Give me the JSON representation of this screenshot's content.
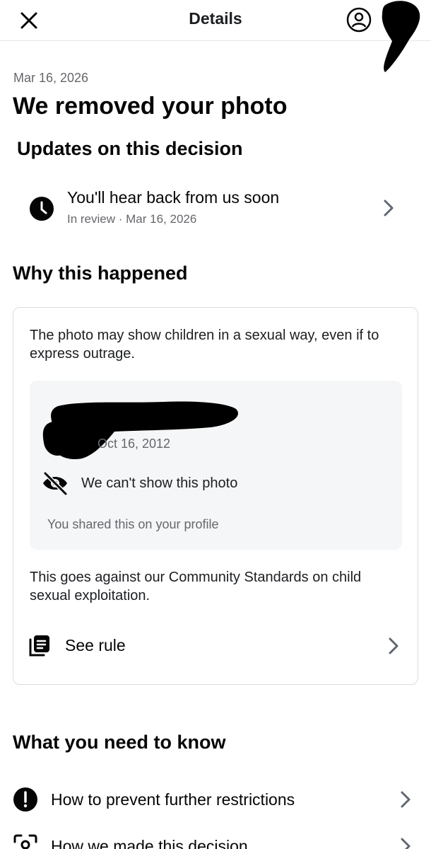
{
  "header": {
    "title": "Details",
    "close_icon": "close-icon",
    "account_icon": "account-circle-icon"
  },
  "notice": {
    "date": "Mar 16, 2026",
    "headline": "We removed your photo"
  },
  "updates": {
    "heading": "Updates on this decision",
    "item": {
      "icon": "clock-icon",
      "title": "You'll hear back from us soon",
      "subtitle": "In review · Mar 16, 2026"
    }
  },
  "why": {
    "heading": "Why this happened",
    "reason": "The photo may show children in a sexual way, even if to express outrage.",
    "post": {
      "date": "Oct 16, 2012",
      "hidden_notice": "We can't show this photo",
      "hidden_icon": "eye-off-icon",
      "shared_text": "You shared this on your profile"
    },
    "standards_text": "This goes against our Community Standards on child sexual exploitation.",
    "rule_link": {
      "label": "See rule",
      "icon": "rulebook-icon"
    }
  },
  "know": {
    "heading": "What you need to know",
    "items": [
      {
        "label": "How to prevent further restrictions",
        "icon": "alert-circle-icon"
      },
      {
        "label": "How we made this decision",
        "icon": "scan-icon"
      }
    ]
  },
  "colors": {
    "text_primary": "#050505",
    "text_secondary": "#65676b",
    "divider": "#dadde1",
    "inner_card_bg": "#f5f6f8"
  }
}
